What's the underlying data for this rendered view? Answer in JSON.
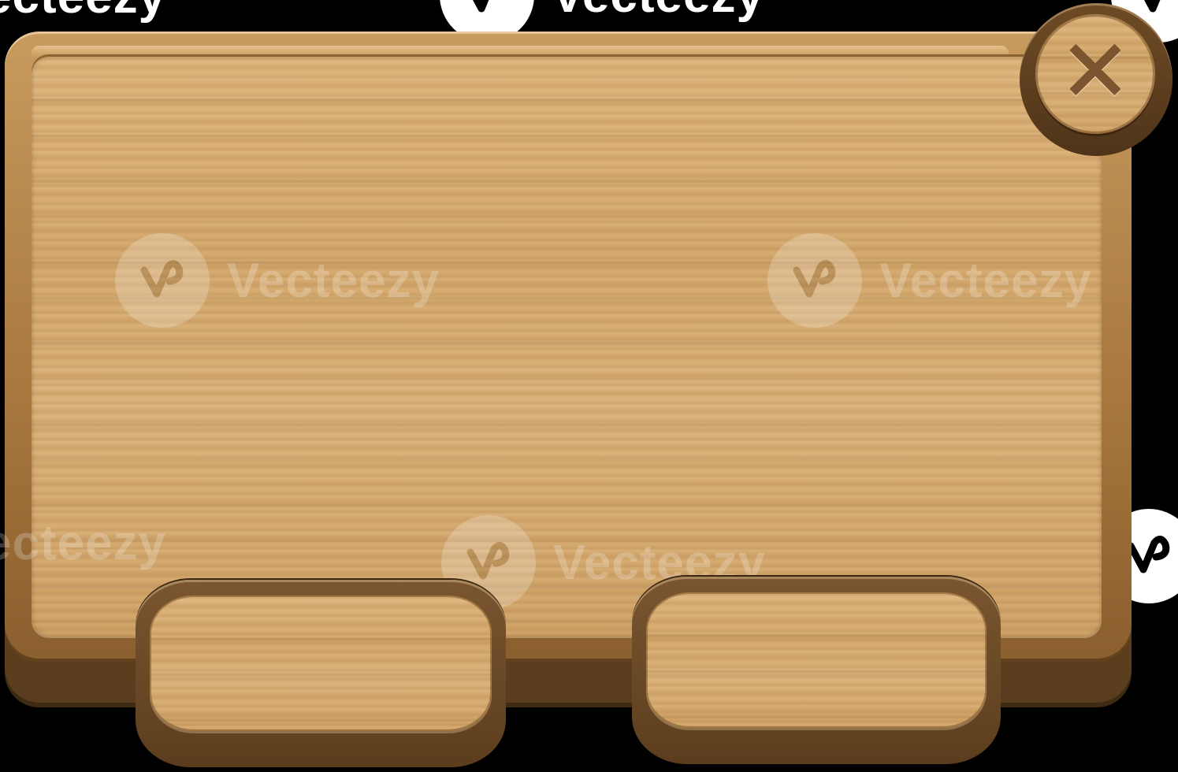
{
  "watermark": {
    "brand": "Vecteezy",
    "partial_left": "ecteezy",
    "partial_right": "ecteezy"
  },
  "dialog": {
    "close_icon": "close-icon",
    "buttons": [
      {
        "name": "left-action-button",
        "label": ""
      },
      {
        "name": "right-action-button",
        "label": ""
      }
    ]
  },
  "colors": {
    "wood_light": "#d8ae72",
    "wood_frame": "#a9793f",
    "wood_dark": "#5a3d1e",
    "background": "#000000"
  }
}
